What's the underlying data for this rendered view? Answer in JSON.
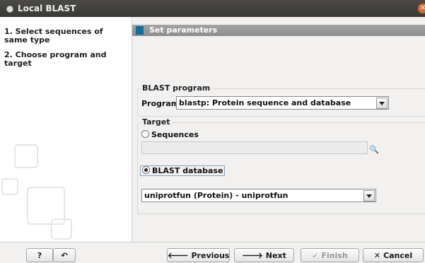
{
  "window": {
    "title": "Local BLAST"
  },
  "steps": [
    {
      "label": "1. Select sequences of same type"
    },
    {
      "label": "2. Choose program and target"
    }
  ],
  "panel": {
    "header": "Set parameters"
  },
  "blast_program": {
    "group_title": "BLAST program",
    "program_label": "Program:",
    "program_value": "blastp: Protein sequence and database"
  },
  "target": {
    "group_title": "Target",
    "sequences_label": "Sequences",
    "sequences_selected": false,
    "database_label": "BLAST database",
    "database_selected": true,
    "database_value": "uniprotfun (Protein) - uniprotfun"
  },
  "buttons": {
    "help": "?",
    "reset": "↶",
    "previous": "Previous",
    "next": "Next",
    "finish": "Finish",
    "cancel": "Cancel"
  },
  "icons": {
    "previous": "arrow-left-icon",
    "next": "arrow-right-icon",
    "finish": "check-icon",
    "cancel": "x-icon"
  }
}
